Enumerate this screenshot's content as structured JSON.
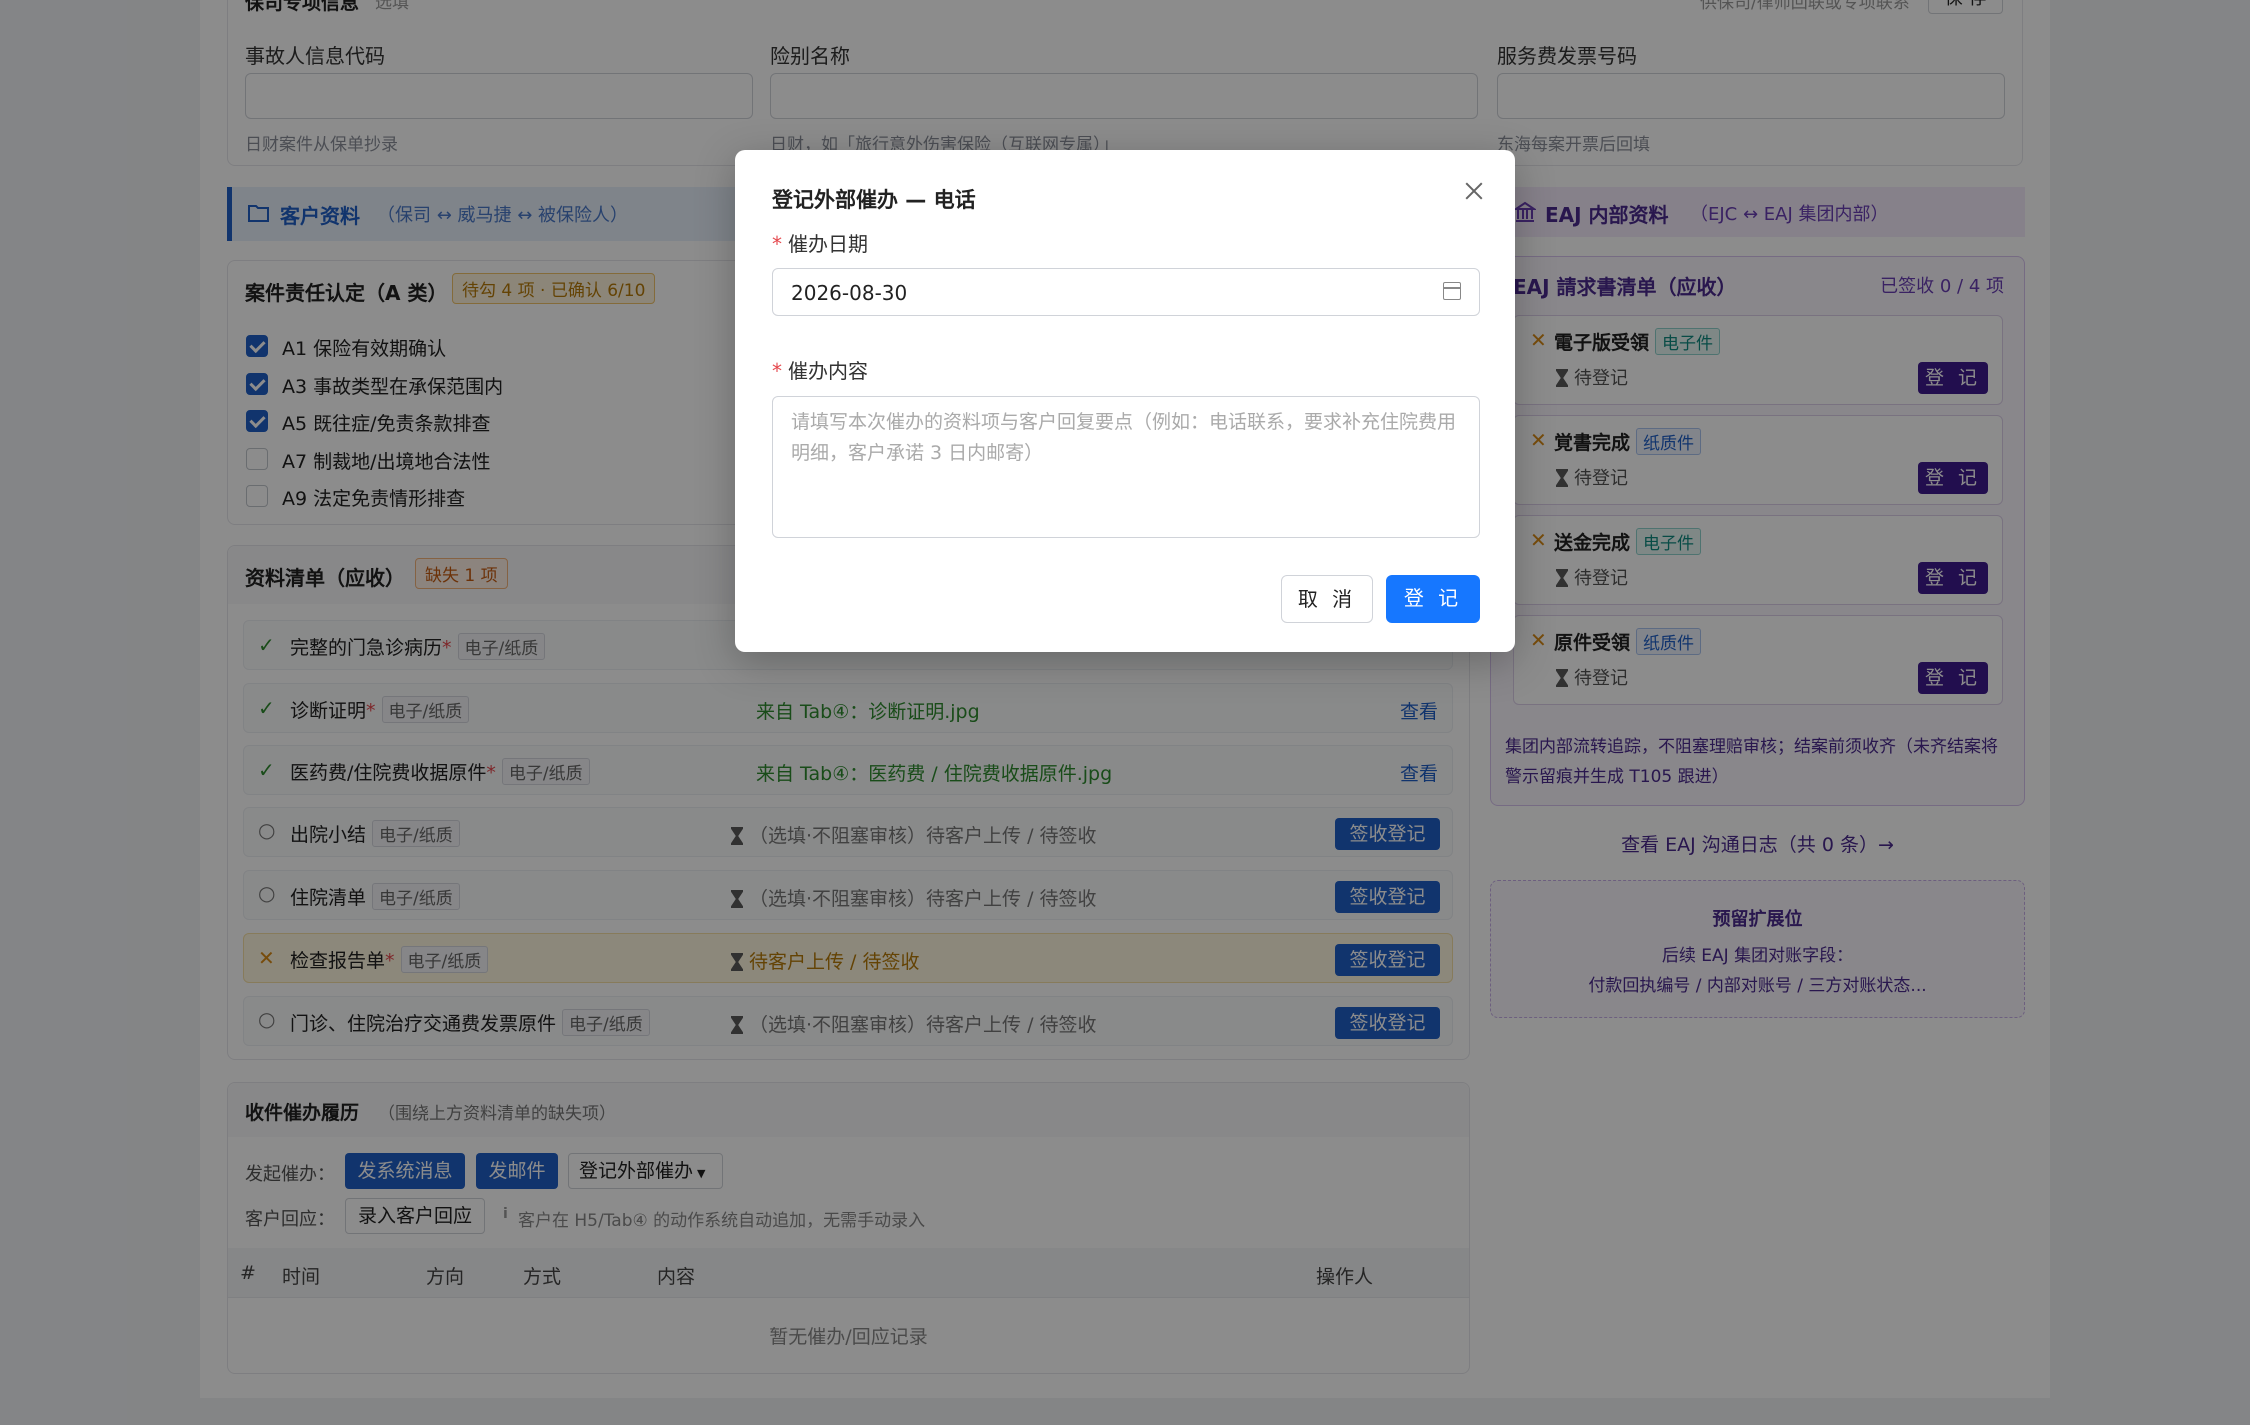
{
  "top": {
    "section_title": "保司专项信息",
    "section_suffix": "选填",
    "right_hint": "供保司/律师回联或专项联系",
    "save_label": "保 存",
    "fields": [
      {
        "label": "事故人信息代码",
        "hint": "日财案件从保单抄录"
      },
      {
        "label": "险别名称",
        "hint": "日财，如「旅行意外伤害保险（互联网专属）」"
      },
      {
        "label": "服务费发票号码",
        "hint": "东海每案开票后回填"
      }
    ]
  },
  "customer_bar": {
    "title": "客户资料",
    "subtitle": "（保司 ↔ 威马捷 ↔ 被保险人）"
  },
  "liability": {
    "title": "案件责任认定（A 类）",
    "badge": "待勾 4 项 · 已确认 6/10",
    "items": [
      {
        "label": "A1 保险有效期确认",
        "checked": true
      },
      {
        "label": "A3 事故类型在承保范围内",
        "checked": true
      },
      {
        "label": "A5 既往症/免责条款排查",
        "checked": true
      },
      {
        "label": "A7 制裁地/出境地合法性",
        "checked": false
      },
      {
        "label": "A9 法定免责情形排查",
        "checked": false
      }
    ]
  },
  "docs": {
    "title": "资料清单（应收）",
    "badge": "缺失 1 项",
    "tag_text": "电子/纸质",
    "rows": [
      {
        "name": "完整的门急诊病历",
        "required": true,
        "status": "done",
        "source": "",
        "action": ""
      },
      {
        "name": "诊断证明",
        "required": true,
        "status": "done",
        "source": "来自 Tab④：诊断证明.jpg",
        "action": "查看"
      },
      {
        "name": "医药费/住院费收据原件",
        "required": true,
        "status": "done",
        "source": "来自 Tab④：医药费 / 住院费收据原件.jpg",
        "action": "查看"
      },
      {
        "name": "出院小结",
        "required": false,
        "status": "optional",
        "source": "（选填·不阻塞审核）待客户上传 / 待签收",
        "action": "签收登记"
      },
      {
        "name": "住院清单",
        "required": false,
        "status": "optional",
        "source": "（选填·不阻塞审核）待客户上传 / 待签收",
        "action": "签收登记"
      },
      {
        "name": "检查报告单",
        "required": true,
        "status": "missing",
        "source": "待客户上传 / 待签收",
        "action": "签收登记"
      },
      {
        "name": "门诊、住院治疗交通费发票原件",
        "required": false,
        "status": "optional",
        "source": "（选填·不阻塞审核）待客户上传 / 待签收",
        "action": "签收登记"
      }
    ]
  },
  "history": {
    "title": "收件催办履历",
    "subtitle": "（围绕上方资料清单的缺失项）",
    "start_label": "发起催办：",
    "btn_system": "发系统消息",
    "btn_mail": "发邮件",
    "btn_external": "登记外部催办",
    "reply_label": "客户回应：",
    "btn_reply": "录入客户回应",
    "reply_hint": "客户在 H5/Tab④ 的动作系统自动追加，无需手动录入",
    "columns": [
      "#",
      "时间",
      "方向",
      "方式",
      "内容",
      "操作人"
    ],
    "empty": "暂无催办/回应记录"
  },
  "eaj": {
    "bar_title": "EAJ 内部资料",
    "bar_subtitle": "（EJC ↔ EAJ 集团内部）",
    "list_title": "EAJ 請求書清单（应收）",
    "signed": "已签收 0 / 4 项",
    "items": [
      {
        "name": "電子版受領",
        "tag": "电子件",
        "status": "待登记",
        "action": "登 记"
      },
      {
        "name": "覚書完成",
        "tag": "纸质件",
        "status": "待登记",
        "action": "登 记"
      },
      {
        "name": "送金完成",
        "tag": "电子件",
        "status": "待登记",
        "action": "登 记"
      },
      {
        "name": "原件受領",
        "tag": "纸质件",
        "status": "待登记",
        "action": "登 记"
      }
    ],
    "note": "集团内部流转追踪，不阻塞理赔审核；结案前须收齐（未齐结案将警示留痕并生成 T105 跟进）",
    "log_link": "查看 EAJ 沟通日志（共 0 条）→",
    "reserved_title": "预留扩展位",
    "reserved_line1": "后续 EAJ 集团对账字段：",
    "reserved_line2": "付款回执编号 / 内部对账号 / 三方对账状态..."
  },
  "modal": {
    "title": "登记外部催办 — 电话",
    "date_label": "催办日期",
    "date_value": "2026-08-30",
    "content_label": "催办内容",
    "content_placeholder": "请填写本次催办的资料项与客户回复要点（例如：电话联系，要求补充住院费用明细，客户承诺 3 日内邮寄）",
    "cancel": "取 消",
    "ok": "登 记"
  },
  "colors": {
    "primary": "#1f5fc7",
    "modal_ok": "#1677ff",
    "purple": "#3e1a8f",
    "success": "#2e8b2e",
    "warning": "#d98a14"
  }
}
